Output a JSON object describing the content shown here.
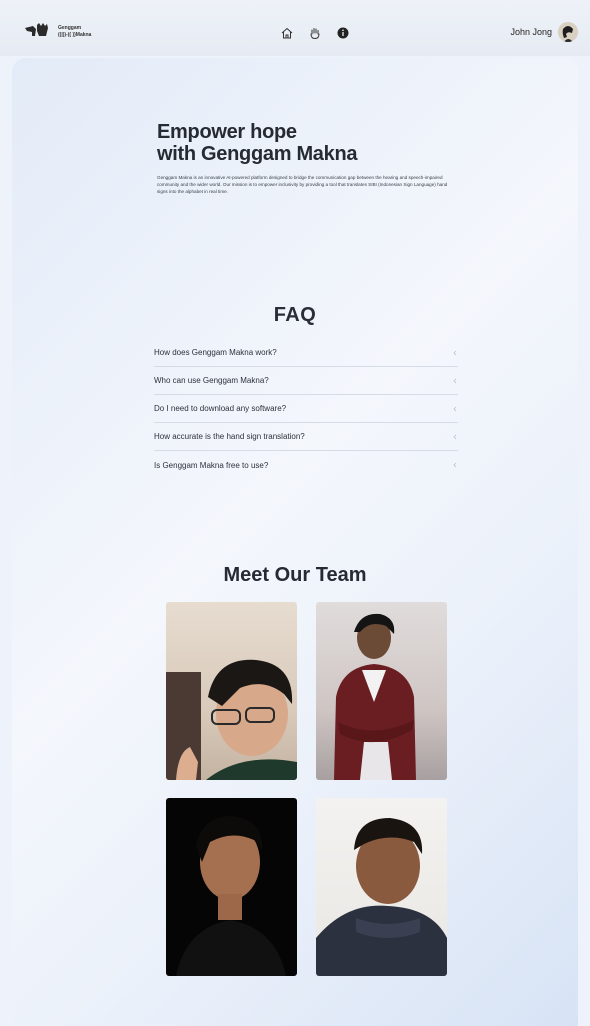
{
  "header": {
    "logo_line1": "Genggam",
    "logo_line2": "((|))-(( ))Makna",
    "nav": [
      "home-icon",
      "hand-icon",
      "info-icon"
    ],
    "user_name": "John Jong"
  },
  "hero": {
    "title": "Empower hope\nwith Genggam Makna",
    "description": "Genggam Makna is an innovative AI-powered platform designed to bridge the communication gap between the hearing and speech-impaired community and the wider world. Our mission is to empower inclusivity by providing a tool that translates SIBI (Indonesian Sign Language) hand signs into the alphabet in real time."
  },
  "faq": {
    "title": "FAQ",
    "items": [
      {
        "question": "How does Genggam Makna work?"
      },
      {
        "question": "Who can use Genggam Makna?"
      },
      {
        "question": "Do I need to download any software?"
      },
      {
        "question": "How accurate is the hand sign translation?"
      },
      {
        "question": "Is Genggam Makna free to use?"
      }
    ]
  },
  "team": {
    "title": "Meet Our Team",
    "members": 4
  },
  "colors": {
    "background": "#eef3fb",
    "text": "#262a33",
    "divider": "#d6dce6"
  }
}
